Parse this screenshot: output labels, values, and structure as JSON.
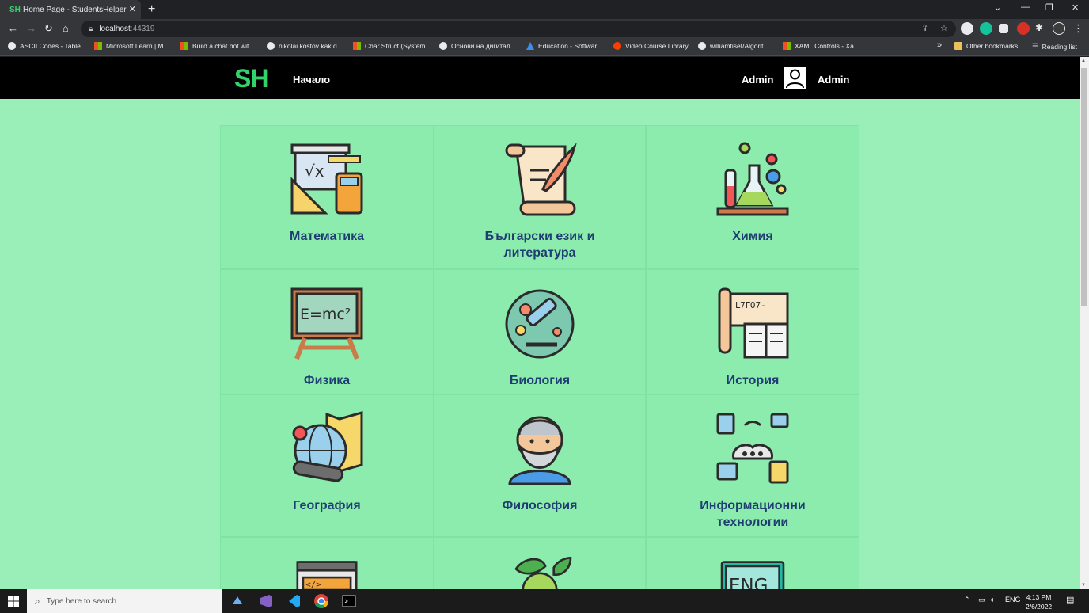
{
  "browser": {
    "tab_favicon": "SH",
    "tab_title": "Home Page - StudentsHelper",
    "url_host": "localhost",
    "url_port": ":44319",
    "bookmarks": [
      {
        "label": "ASCII Codes - Table...",
        "icon": "circle-icon"
      },
      {
        "label": "Microsoft Learn | M...",
        "icon": "microsoft-icon"
      },
      {
        "label": "Build a chat bot wit...",
        "icon": "microsoft-icon"
      },
      {
        "label": "nikolai kostov kak d...",
        "icon": "google-icon"
      },
      {
        "label": "Char Struct (System...",
        "icon": "microsoft-icon"
      },
      {
        "label": "Основи на дигитал...",
        "icon": "google-icon"
      },
      {
        "label": "Education - Softwar...",
        "icon": "azure-icon"
      },
      {
        "label": "Video Course Library",
        "icon": "youtube-icon"
      },
      {
        "label": "williamfiset/Algorit...",
        "icon": "github-icon"
      },
      {
        "label": "XAML Controls - Xa...",
        "icon": "microsoft-icon"
      }
    ],
    "more_bookmarks": "»",
    "other_bookmarks": "Other bookmarks",
    "reading_list": "Reading list"
  },
  "navbar": {
    "logo": "SH",
    "home_link": "Начало",
    "admin_link": "Admin",
    "user_name": "Admin"
  },
  "subjects": [
    {
      "label": "Математика",
      "icon": "math-icon"
    },
    {
      "label": "Български език и литература",
      "icon": "scroll-quill-icon"
    },
    {
      "label": "Химия",
      "icon": "chemistry-icon"
    },
    {
      "label": "Физика",
      "icon": "blackboard-icon"
    },
    {
      "label": "Биология",
      "icon": "microscope-icon"
    },
    {
      "label": "История",
      "icon": "history-book-icon"
    },
    {
      "label": "География",
      "icon": "globe-icon"
    },
    {
      "label": "Философия",
      "icon": "philosopher-icon"
    },
    {
      "label": "Информационни технологии",
      "icon": "network-icon"
    },
    {
      "label": "",
      "icon": "code-window-icon"
    },
    {
      "label": "",
      "icon": "leaves-icon"
    },
    {
      "label": "",
      "icon": "english-board-icon"
    }
  ],
  "taskbar": {
    "search_placeholder": "Type here to search",
    "language": "ENG",
    "time": "4:13 PM",
    "date": "2/6/2022"
  },
  "colors": {
    "page_background": "#99efb7",
    "card_background": "#8cecad",
    "label_color": "#1f3d73",
    "logo_color": "#31d36b",
    "navbar_background": "#000000"
  }
}
